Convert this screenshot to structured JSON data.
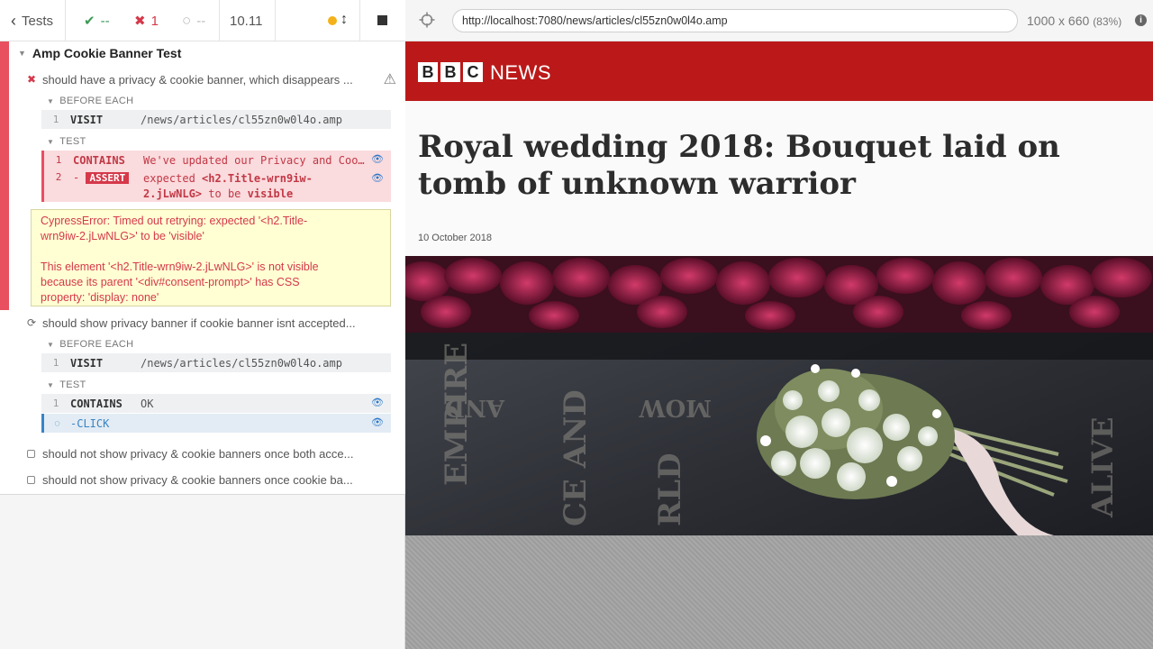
{
  "stats": {
    "tests_label": "Tests",
    "passed": "--",
    "failed": "1",
    "pending": "--",
    "duration": "10.11"
  },
  "suite": {
    "title": "Amp Cookie Banner Test",
    "tests": [
      {
        "title": "should have a privacy & cookie banner, which disappears ...",
        "state": "failed",
        "before_each_label": "BEFORE EACH",
        "before_each": [
          {
            "num": "1",
            "name": "VISIT",
            "message": "/news/articles/cl55zn0w0l4o.amp"
          }
        ],
        "test_label": "TEST",
        "commands": [
          {
            "num": "1",
            "name": "CONTAINS",
            "message": "We've updated our Privacy and Coo..."
          },
          {
            "num": "2",
            "name": "- ASSERT",
            "message_pre": "expected",
            "message_sel": "<h2.Title-wrn9iw-",
            "message_sel2": "2.jLwNLG>",
            "message_mid": "to be",
            "message_end": "visible"
          }
        ],
        "error": {
          "line1": "CypressError: Timed out retrying: expected '<h2.Title-",
          "line2": "wrn9iw-2.jLwNLG>' to be 'visible'",
          "line3": "This element '<h2.Title-wrn9iw-2.jLwNLG>' is not visible",
          "line4": "because its parent '<div#consent-prompt>' has CSS",
          "line5": "property: 'display: none'"
        }
      },
      {
        "title": "should show privacy banner if cookie banner isnt accepted...",
        "state": "running",
        "before_each_label": "BEFORE EACH",
        "before_each": [
          {
            "num": "1",
            "name": "VISIT",
            "message": "/news/articles/cl55zn0w0l4o.amp"
          }
        ],
        "test_label": "TEST",
        "commands": [
          {
            "num": "1",
            "name": "CONTAINS",
            "message": "OK"
          },
          {
            "num": "",
            "name": "-CLICK",
            "message": ""
          }
        ]
      },
      {
        "title": "should not show privacy & cookie banners once both acce...",
        "state": "pending"
      },
      {
        "title": "should not show privacy & cookie banners once cookie ba...",
        "state": "pending"
      }
    ]
  },
  "aut": {
    "url": "http://localhost:7080/news/articles/cl55zn0w0l4o.amp",
    "viewport": "1000 x 660",
    "scale": "(83%)",
    "info": "i"
  },
  "article": {
    "brand_letters": [
      "B",
      "B",
      "C"
    ],
    "brand_news": "NEWS",
    "headline": "Royal wedding 2018: Bouquet laid on tomb of unknown warrior",
    "date": "10 October 2018",
    "hero_text": [
      "EMPIRE",
      "CE AND",
      "RLD",
      "ALIVE",
      "AND",
      "MOW"
    ]
  },
  "colors": {
    "fail": "#e9505f",
    "pass": "#3d9a55",
    "bbc_red": "#bb1919",
    "pending_blue": "#3a84c4"
  }
}
